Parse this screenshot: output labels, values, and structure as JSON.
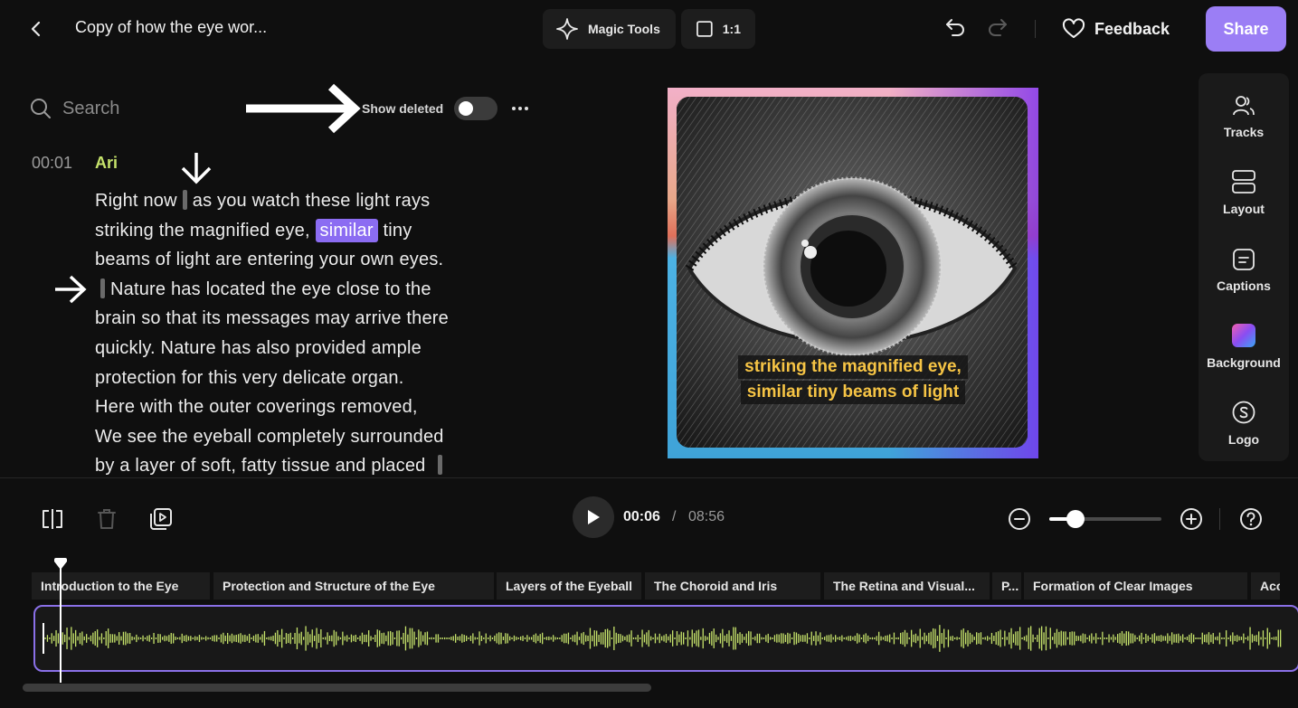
{
  "header": {
    "title": "Copy of how the eye wor...",
    "magic_tools_label": "Magic Tools",
    "aspect_ratio_label": "1:1",
    "feedback_label": "Feedback",
    "share_label": "Share"
  },
  "transcript_panel": {
    "search_placeholder": "Search",
    "show_deleted_label": "Show deleted",
    "show_deleted_on": false,
    "timestamp": "00:01",
    "speaker": "Ari",
    "lines": {
      "l1a": "Right now",
      "l1b": "as you watch these light rays",
      "l2a": "striking the magnified eye,",
      "l2_highlight": "similar",
      "l2b": "tiny",
      "l3": "beams of light are entering your own eyes.",
      "l4": "Nature has located the eye close to the",
      "l5": "brain so that its messages may arrive there",
      "l6": "quickly. Nature has also provided ample",
      "l7": "protection for this very delicate organ.",
      "l8": "Here with the outer coverings removed,",
      "l9": "We see the eyeball completely surrounded",
      "l10": "by a layer of soft, fatty tissue and placed"
    }
  },
  "preview": {
    "caption_line1": "striking the magnified eye,",
    "caption_line2": "similar tiny beams of light"
  },
  "side_panel": {
    "items": [
      {
        "label": "Tracks",
        "icon": "users-icon"
      },
      {
        "label": "Layout",
        "icon": "layout-icon"
      },
      {
        "label": "Captions",
        "icon": "captions-icon"
      },
      {
        "label": "Background",
        "icon": "gradient-swatch-icon"
      },
      {
        "label": "Logo",
        "icon": "logo-icon"
      }
    ]
  },
  "playback": {
    "current_time": "00:06",
    "separator": "/",
    "total_time": "08:56",
    "zoom_fraction": 0.2,
    "progress_fraction": 0.012
  },
  "timeline": {
    "chapters": [
      "Introduction to the Eye",
      "Protection and Structure of the Eye",
      "Layers of the Eyeball",
      "The Choroid and Iris",
      "The Retina and Visual...",
      "P...",
      "Formation of Clear Images",
      "Acc..."
    ]
  },
  "colors": {
    "accent": "#9b7ef5",
    "speaker": "#c6e36b",
    "waveform": "#c6e36b",
    "caption": "#f6c445",
    "clip_border": "#8a70e8"
  }
}
